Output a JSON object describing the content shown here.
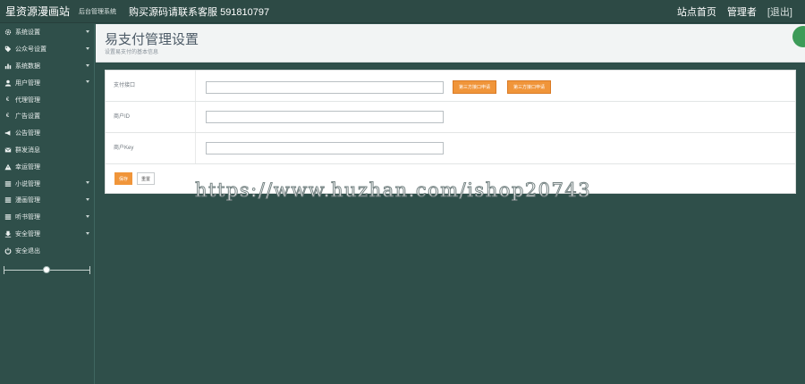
{
  "topbar": {
    "brand": "星资源漫画站",
    "brand_sub": "后台管理系统",
    "notice": "购买源码请联系客服 591810797",
    "home_link": "站点首页",
    "admin_link": "管理者",
    "logout_link": "[退出]"
  },
  "sidebar": {
    "items": [
      {
        "label": "系统设置",
        "icon": "gear-icon",
        "expandable": true
      },
      {
        "label": "公众号设置",
        "icon": "tag-icon",
        "expandable": true
      },
      {
        "label": "系统数据",
        "icon": "bar-chart-icon",
        "expandable": true
      },
      {
        "label": "用户管理",
        "icon": "user-icon",
        "expandable": true
      },
      {
        "label": "代理管理",
        "icon": "euro-icon",
        "expandable": false
      },
      {
        "label": "广告设置",
        "icon": "euro-icon",
        "expandable": false
      },
      {
        "label": "公告管理",
        "icon": "megaphone-icon",
        "expandable": false
      },
      {
        "label": "群发消息",
        "icon": "mail-icon",
        "expandable": false
      },
      {
        "label": "幸运管理",
        "icon": "warning-icon",
        "expandable": false
      },
      {
        "label": "小说管理",
        "icon": "list-icon",
        "expandable": true
      },
      {
        "label": "漫画管理",
        "icon": "list-icon",
        "expandable": true
      },
      {
        "label": "听书管理",
        "icon": "list-icon",
        "expandable": true
      },
      {
        "label": "安全管理",
        "icon": "download-icon",
        "expandable": true
      },
      {
        "label": "安全退出",
        "icon": "power-icon",
        "expandable": false
      }
    ]
  },
  "header": {
    "title": "易支付管理设置",
    "subtitle": "设置易支付的基本信息"
  },
  "form": {
    "rows": [
      {
        "label": "支付接口",
        "value": "",
        "placeholder": ""
      },
      {
        "label": "商户ID",
        "value": "",
        "placeholder": ""
      },
      {
        "label": "商户Key",
        "value": "",
        "placeholder": ""
      }
    ],
    "apply_button_1": "第三方接口申请",
    "apply_button_2": "第三方接口申请",
    "save_button": "保存",
    "reset_button": "重置"
  },
  "watermark": "https://www.huzhan.com/ishop20743",
  "colors": {
    "sidebar_bg": "#2f4f4a",
    "accent_orange": "#f0953a",
    "fab_green": "#3d9b58"
  }
}
